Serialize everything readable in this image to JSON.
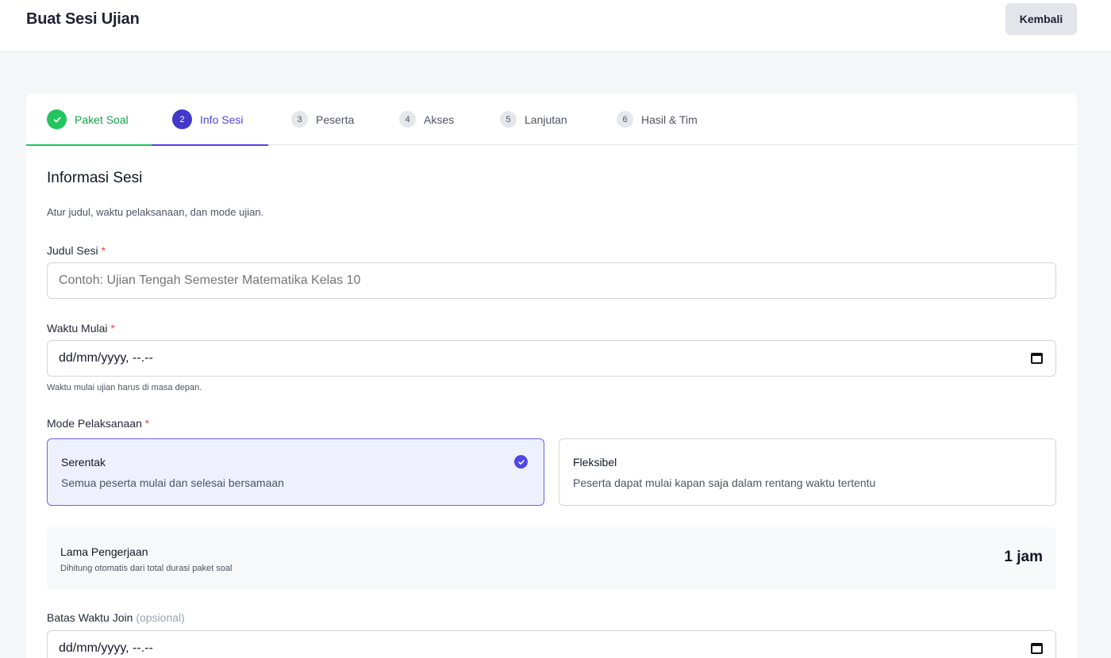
{
  "header": {
    "title": "Buat Sesi Ujian",
    "back_label": "Kembali"
  },
  "steps": [
    {
      "number": "1",
      "label": "Paket Soal",
      "state": "done"
    },
    {
      "number": "2",
      "label": "Info Sesi",
      "state": "active"
    },
    {
      "number": "3",
      "label": "Peserta",
      "state": "pending"
    },
    {
      "number": "4",
      "label": "Akses",
      "state": "pending"
    },
    {
      "number": "5",
      "label": "Lanjutan",
      "state": "pending"
    },
    {
      "number": "6",
      "label": "Hasil & Tim",
      "state": "pending"
    }
  ],
  "section": {
    "title": "Informasi Sesi",
    "description": "Atur judul, waktu pelaksanaan, dan mode ujian."
  },
  "fields": {
    "title_label": "Judul Sesi",
    "title_placeholder": "Contoh: Ujian Tengah Semester Matematika Kelas 10",
    "start_label": "Waktu Mulai",
    "start_value": "dd/mm/yyyy, --.--",
    "start_hint": "Waktu mulai ujian harus di masa depan.",
    "mode_label": "Mode Pelaksanaan",
    "required_mark": "*",
    "join_label": "Batas Waktu Join",
    "join_optional": "(opsional)",
    "join_value": "dd/mm/yyyy, --.--"
  },
  "modes": [
    {
      "title": "Serentak",
      "description": "Semua peserta mulai dan selesai bersamaan",
      "selected": true
    },
    {
      "title": "Fleksibel",
      "description": "Peserta dapat mulai kapan saja dalam rentang waktu tertentu",
      "selected": false
    }
  ],
  "duration": {
    "label": "Lama Pengerjaan",
    "subtitle": "Dihitung otomatis dari total durasi paket soal",
    "value": "1 jam"
  },
  "colors": {
    "accent": "#4f46e5",
    "success": "#22c55e",
    "required": "#ef4444"
  }
}
